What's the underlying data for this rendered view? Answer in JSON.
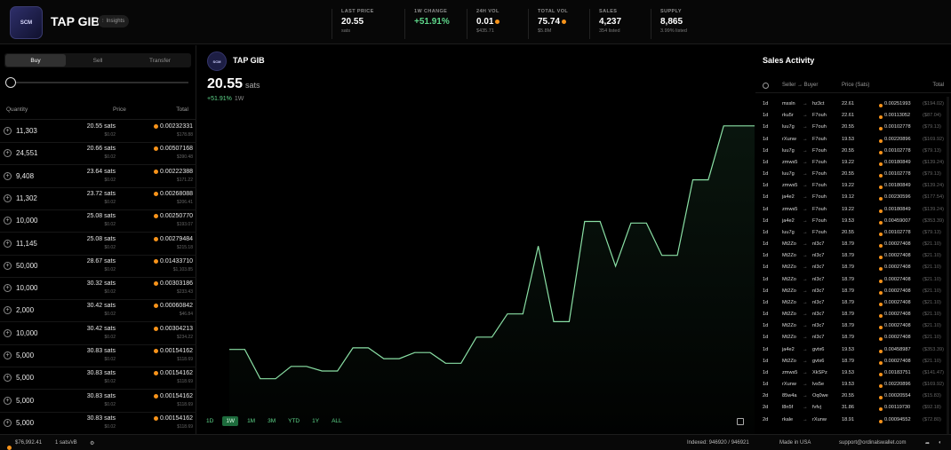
{
  "header": {
    "logo_text": "SCM",
    "ticker": "TAP GIB",
    "insights_label": "Insights",
    "stats": [
      {
        "label": "LAST PRICE",
        "value": "20.55",
        "sub": "sats"
      },
      {
        "label": "1W CHANGE",
        "value": "+51.91%",
        "sub": ""
      },
      {
        "label": "24H VOL",
        "value": "0.01",
        "sub": "$435.71"
      },
      {
        "label": "TOTAL VOL",
        "value": "75.74",
        "sub": "$5.8M"
      },
      {
        "label": "SALES",
        "value": "4,237",
        "sub": "354 listed"
      },
      {
        "label": "SUPPLY",
        "value": "8,865",
        "sub": "3.99% listed"
      }
    ]
  },
  "trade": {
    "tabs": [
      "Buy",
      "Sell",
      "Transfer"
    ],
    "active_tab": "Buy",
    "col_quantity": "Quantity",
    "col_price": "Price",
    "col_total": "Total",
    "orders": [
      {
        "qty": "11,303",
        "price": "20.55 sats",
        "price_usd": "$0.02",
        "total": "0.00232331",
        "total_usd": "$178.88"
      },
      {
        "qty": "24,551",
        "price": "20.66 sats",
        "price_usd": "$0.02",
        "total": "0.00507168",
        "total_usd": "$390.48"
      },
      {
        "qty": "9,408",
        "price": "23.64 sats",
        "price_usd": "$0.02",
        "total": "0.00222388",
        "total_usd": "$171.22"
      },
      {
        "qty": "11,302",
        "price": "23.72 sats",
        "price_usd": "$0.02",
        "total": "0.00268088",
        "total_usd": "$206.41"
      },
      {
        "qty": "10,000",
        "price": "25.08 sats",
        "price_usd": "$0.02",
        "total": "0.00250770",
        "total_usd": "$193.07"
      },
      {
        "qty": "11,145",
        "price": "25.08 sats",
        "price_usd": "$0.02",
        "total": "0.00279484",
        "total_usd": "$215.18"
      },
      {
        "qty": "50,000",
        "price": "28.67 sats",
        "price_usd": "$0.02",
        "total": "0.01433710",
        "total_usd": "$1,103.85"
      },
      {
        "qty": "10,000",
        "price": "30.32 sats",
        "price_usd": "$0.02",
        "total": "0.00303186",
        "total_usd": "$233.43"
      },
      {
        "qty": "2,000",
        "price": "30.42 sats",
        "price_usd": "$0.02",
        "total": "0.00060842",
        "total_usd": "$46.84"
      },
      {
        "qty": "10,000",
        "price": "30.42 sats",
        "price_usd": "$0.02",
        "total": "0.00304213",
        "total_usd": "$234.22"
      },
      {
        "qty": "5,000",
        "price": "30.83 sats",
        "price_usd": "$0.02",
        "total": "0.00154162",
        "total_usd": "$118.69"
      },
      {
        "qty": "5,000",
        "price": "30.83 sats",
        "price_usd": "$0.02",
        "total": "0.00154162",
        "total_usd": "$118.69"
      },
      {
        "qty": "5,000",
        "price": "30.83 sats",
        "price_usd": "$0.02",
        "total": "0.00154162",
        "total_usd": "$118.69"
      },
      {
        "qty": "5,000",
        "price": "30.83 sats",
        "price_usd": "$0.02",
        "total": "0.00154162",
        "total_usd": "$118.69"
      }
    ]
  },
  "chart": {
    "title": "TAP GIB",
    "logo_text": "SCM",
    "price": "20.55",
    "unit": "sats",
    "change": "+51.91%",
    "period": "1W",
    "ranges": [
      "1D",
      "1W",
      "1M",
      "3M",
      "YTD",
      "1Y",
      "ALL"
    ],
    "active_range": "1W"
  },
  "chart_data": {
    "type": "line",
    "title": "",
    "xlabel": "",
    "ylabel": "",
    "ylim": [
      13,
      32
    ],
    "grid": false,
    "y": [
      16.3,
      16.3,
      14.4,
      14.4,
      15.2,
      15.2,
      14.9,
      14.9,
      16.4,
      16.4,
      15.7,
      15.7,
      16.1,
      16.1,
      15.4,
      15.4,
      17.1,
      17.1,
      18.6,
      18.6,
      23.0,
      18.1,
      18.1,
      24.6,
      24.6,
      21.7,
      24.5,
      24.5,
      22.4,
      22.4,
      27.3,
      27.3,
      30.8,
      30.8,
      30.8
    ]
  },
  "sales": {
    "title": "Sales Activity",
    "col_seller_buyer": "Seller → Buyer",
    "col_price": "Price (Sats)",
    "col_total": "Total",
    "rows": [
      {
        "age": "1d",
        "seller": "mssln",
        "buyer": "hz3ct",
        "price": "22.61",
        "total": "0.00251993",
        "usd": "($194.02)"
      },
      {
        "age": "1d",
        "seller": "rku5r",
        "buyer": "F7ouh",
        "price": "22.61",
        "total": "0.00113052",
        "usd": "($87.04)"
      },
      {
        "age": "1d",
        "seller": "luu7g",
        "buyer": "F7ouh",
        "price": "20.55",
        "total": "0.00102778",
        "usd": "($79.13)"
      },
      {
        "age": "1d",
        "seller": "rXunw",
        "buyer": "F7ouh",
        "price": "19.53",
        "total": "0.00220896",
        "usd": "($169.92)"
      },
      {
        "age": "1d",
        "seller": "luu7g",
        "buyer": "F7ouh",
        "price": "20.55",
        "total": "0.00102778",
        "usd": "($79.13)"
      },
      {
        "age": "1d",
        "seller": "zmws5",
        "buyer": "F7ouh",
        "price": "19.22",
        "total": "0.00180849",
        "usd": "($139.24)"
      },
      {
        "age": "1d",
        "seller": "luu7g",
        "buyer": "F7ouh",
        "price": "20.55",
        "total": "0.00102778",
        "usd": "($79.13)"
      },
      {
        "age": "1d",
        "seller": "zmws5",
        "buyer": "F7ouh",
        "price": "19.22",
        "total": "0.00180849",
        "usd": "($139.24)"
      },
      {
        "age": "1d",
        "seller": "ja4e2",
        "buyer": "F7ouh",
        "price": "19.12",
        "total": "0.00230596",
        "usd": "($177.54)"
      },
      {
        "age": "1d",
        "seller": "zmws5",
        "buyer": "F7ouh",
        "price": "19.22",
        "total": "0.00180849",
        "usd": "($139.24)"
      },
      {
        "age": "1d",
        "seller": "ja4e2",
        "buyer": "F7ouh",
        "price": "19.53",
        "total": "0.00459007",
        "usd": "($353.39)"
      },
      {
        "age": "1d",
        "seller": "luu7g",
        "buyer": "F7ouh",
        "price": "20.55",
        "total": "0.00102778",
        "usd": "($79.13)"
      },
      {
        "age": "1d",
        "seller": "Mt2Zo",
        "buyer": "nl3c7",
        "price": "18.79",
        "total": "0.00027408",
        "usd": "($21.10)"
      },
      {
        "age": "1d",
        "seller": "Mt2Zo",
        "buyer": "nl3c7",
        "price": "18.79",
        "total": "0.00027408",
        "usd": "($21.10)"
      },
      {
        "age": "1d",
        "seller": "Mt2Zo",
        "buyer": "nl3c7",
        "price": "18.79",
        "total": "0.00027408",
        "usd": "($21.10)"
      },
      {
        "age": "1d",
        "seller": "Mt2Zo",
        "buyer": "nl3c7",
        "price": "18.79",
        "total": "0.00027408",
        "usd": "($21.10)"
      },
      {
        "age": "1d",
        "seller": "Mt2Zo",
        "buyer": "nl3c7",
        "price": "18.79",
        "total": "0.00027408",
        "usd": "($21.10)"
      },
      {
        "age": "1d",
        "seller": "Mt2Zo",
        "buyer": "nl3c7",
        "price": "18.79",
        "total": "0.00027408",
        "usd": "($21.10)"
      },
      {
        "age": "1d",
        "seller": "Mt2Zo",
        "buyer": "nl3c7",
        "price": "18.79",
        "total": "0.00027408",
        "usd": "($21.10)"
      },
      {
        "age": "1d",
        "seller": "Mt2Zo",
        "buyer": "nl3c7",
        "price": "18.79",
        "total": "0.00027408",
        "usd": "($21.10)"
      },
      {
        "age": "1d",
        "seller": "Mt2Zo",
        "buyer": "nl3c7",
        "price": "18.79",
        "total": "0.00027408",
        "usd": "($21.10)"
      },
      {
        "age": "1d",
        "seller": "ja4e2",
        "buyer": "gvtx6",
        "price": "19.53",
        "total": "0.00458987",
        "usd": "($353.39)"
      },
      {
        "age": "1d",
        "seller": "Mt2Zo",
        "buyer": "gvtx6",
        "price": "18.79",
        "total": "0.00027408",
        "usd": "($21.10)"
      },
      {
        "age": "1d",
        "seller": "zmws5",
        "buyer": "XkSPz",
        "price": "19.53",
        "total": "0.00183751",
        "usd": "($141.47)"
      },
      {
        "age": "1d",
        "seller": "rXunw",
        "buyer": "lvs5e",
        "price": "19.53",
        "total": "0.00220896",
        "usd": "($169.92)"
      },
      {
        "age": "2d",
        "seller": "85w4a",
        "buyer": "Oq0we",
        "price": "20.55",
        "total": "0.00020554",
        "usd": "($15.83)"
      },
      {
        "age": "2d",
        "seller": "l8n5f",
        "buyer": "fvfvj",
        "price": "31.86",
        "total": "0.00119730",
        "usd": "($92.18)"
      },
      {
        "age": "2d",
        "seller": "rkale",
        "buyer": "rXunw",
        "price": "18.91",
        "total": "0.00094552",
        "usd": "($72.80)"
      }
    ]
  },
  "footer": {
    "btc_price": "$76,992.41",
    "fee": "1 sats/vB",
    "indexed": "Indexed: 946920 / 946921",
    "made_in": "Made in USA",
    "support": "support@ordinalswallet.com"
  },
  "colors": {
    "accent_green": "#5ed68a",
    "btc_orange": "#f7931a",
    "background": "#000000"
  }
}
